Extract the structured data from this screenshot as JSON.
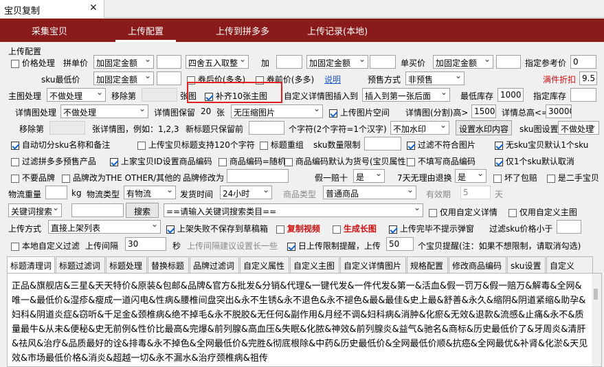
{
  "window": {
    "tab_title": "宝贝复制",
    "close": "×"
  },
  "nav": {
    "items": [
      "采集宝贝",
      "上传配置",
      "上传到拼多多",
      "上传记录(本地)"
    ],
    "active": 1
  },
  "section_label": "上传配置",
  "r1": {
    "price_cb": "价格处理",
    "single_price": "拼单价",
    "sel1": "加固定金额",
    "sel2": "四舍五入取整",
    "add": "加",
    "sel3": "加固定金额",
    "buy_price": "单买价",
    "sel4": "加固定金额",
    "ref_price": "指定参考价",
    "ref_val": "0"
  },
  "r2": {
    "sku_low": "sku最低价",
    "sel1": "加固定金额",
    "coupon_after": "券后价(多多)",
    "coupon_before": "券前价(多多)",
    "explain": "说明",
    "presale": "预售方式",
    "presale_sel": "非预售",
    "full_discount": "满件折扣",
    "discount_val": "9.5"
  },
  "r3": {
    "main_img": "主图处理",
    "main_sel": "不做处理",
    "remove_nth": "移除第",
    "img": "张图",
    "fill10": "补齐10张主图",
    "custom_detail": "自定义详情图插入到",
    "insert_sel": "插入到第一张后面",
    "min_stock": "最低库存",
    "min_stock_val": "1000",
    "set_stock": "指定库存"
  },
  "r4": {
    "detail_img": "详情图处理",
    "detail_sel": "不做处理",
    "keep": "详情图保留",
    "keep_val": "20",
    "zhang": "张",
    "compress_sel": "无压缩图片",
    "upload_space": "上传图片空间",
    "split_height": "详情图(分割)高>",
    "split_val": "1500",
    "total_height": "详情总高<=",
    "total_val": "30000"
  },
  "r5": {
    "remove_nth": "移除第",
    "example": "张详情图，例如：1,2,3",
    "new_title": "新标题只保留前",
    "chars": "个字符(2个字符=1个汉字)",
    "watermark_sel": "不加水印",
    "watermark_btn": "设置水印内容",
    "sku_img": "sku图设置",
    "sku_sel": "不做处理"
  },
  "r6": {
    "auto_split": "自动切分sku名称和备注",
    "title120": "上传宝贝标题支持120个字符",
    "retitle": "标题重组",
    "sku_limit": "sku数量限制",
    "filter_bad": "过滤不符合图片",
    "no_sku_img": "无sku宝贝默认1个sku"
  },
  "r7": {
    "filter_pdd": "过滤拼多多预售产品",
    "shop_id": "上家宝贝ID设置商品编码",
    "code_random": "商品编码=随机",
    "code_default": "商品编码默认为货号(宝贝属性)",
    "no_fill_code": "不填写商品编码",
    "only1_sku": "仅1个sku默认取消"
  },
  "r8": {
    "no_brand": "不要品牌",
    "brand_other": "品牌改为THE OTHER/其他的",
    "brand_modify": "品牌修改为",
    "fake_pay": "假一赔十",
    "fake_sel": "是",
    "seven_days": "7天无理由退换",
    "seven_sel": "是",
    "broken_pay": "坏了包赔",
    "second_hand": "是二手宝贝"
  },
  "r9": {
    "weight": "物流重量",
    "kg": "kg",
    "logistics_type": "物流类型",
    "logistics_sel": "有物流",
    "ship_time": "发货时间",
    "ship_sel": "24小时",
    "goods_type": "商品类型",
    "goods_sel": "普通商品",
    "valid": "有效期",
    "valid_val": "5",
    "day": "天"
  },
  "r10": {
    "kw_sel": "关键词搜索",
    "search_btn": "搜索",
    "cat_sel": "==请输入关键词搜索类目==",
    "only_custom_detail": "仅用自定义详情",
    "only_custom_main": "仅用自定义主图"
  },
  "r11": {
    "upload_mode": "上传方式",
    "mode_sel": "直接上架列表",
    "fail_draft": "上架失败不保存到草稿箱",
    "copy_video": "复制视频",
    "gen_long": "生成长图",
    "no_popup": "上传完毕不提示弹窗",
    "filter_sku": "过滤sku价格小于"
  },
  "r12": {
    "local_filter": "本地自定义过滤",
    "interval": "上传间隔",
    "interval_val": "30",
    "sec": "秒",
    "interval_tip": "上传间隔建议设置长一些",
    "daily_limit": "日上传限制提醒，上传",
    "daily_val": "50",
    "daily_tip": "个宝贝提醒(注：如果不想限制，请取消勾选)"
  },
  "tabs2": [
    "标题清理词",
    "标题过滤词",
    "标题处理",
    "替换标题",
    "品牌过滤词",
    "自定义属性",
    "自定义主图",
    "自定义详情图片",
    "规格配置",
    "修改商品编码",
    "sku设置",
    "自定义SKU"
  ],
  "textarea_text": "正品&旗舰店&三星&天天特价&原装&包邮&品牌&官方&批发&分销&代理&一键代发&一件代发&第一&活血&假一罚万&假一赔万&解毒&全网&唯一&最低价&湿疹&瘦成一道闪电&性病&腰椎间盘突出&永不生锈&永不退色&永不褪色&最&最佳&史上最&舒善&永久&缩阴&阴道紧缩&助孕&妇科&阴道炎症&窃听&千足金&颈椎病&绝不掉毛&永不脱胶&无任何&副作用&月经不调&妇科病&消肿&化瘀&无效&退款&流感&止痛&永不&质量最牛&从未&便秘&史无前例&性价比最高&完爆&前列腺&高血压&失眠&化脓&神效&前列腺炎&益气&驰名&商标&历史最低价了&牙周炎&清肝&祛风&治疗&品质最好的诠&排毒&永不掉色&全网最低价&完胜&彻底根除&中药&历史最低价&全网最低价顺&抗癌&全网最优&补肾&化淤&天见效&市场最低价格&消炎&超越一切&永不漏水&治疗颈椎病&祖传"
}
